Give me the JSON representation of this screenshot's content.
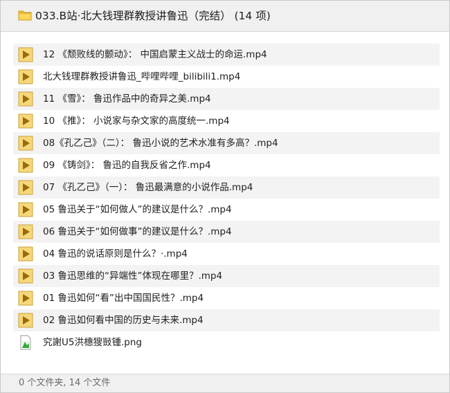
{
  "window": {
    "title": "033.B站·北大钱理群教授讲鲁迅（完结） (14 项)",
    "title_icon": "folder-icon"
  },
  "files": [
    {
      "name": "12 《颓败线的颤动》： 中国启蒙主义战士的命运.mp4",
      "type": "video",
      "icon": "video-file-icon"
    },
    {
      "name": "北大钱理群教授讲鲁迅_哔哩哔哩_bilibili1.mp4",
      "type": "video",
      "icon": "video-file-icon"
    },
    {
      "name": "11 《雪》： 鲁迅作品中的奇异之美.mp4",
      "type": "video",
      "icon": "video-file-icon"
    },
    {
      "name": "10 《推》： 小说家与杂文家的高度统一.mp4",
      "type": "video",
      "icon": "video-file-icon"
    },
    {
      "name": "08《孔乙己》（二）： 鲁迅小说的艺术水准有多高？.mp4",
      "type": "video",
      "icon": "video-file-icon"
    },
    {
      "name": "09 《铸剑》： 鲁迅的自我反省之作.mp4",
      "type": "video",
      "icon": "video-file-icon"
    },
    {
      "name": "07 《孔乙己》（一）： 鲁迅最满意的小说作品.mp4",
      "type": "video",
      "icon": "video-file-icon"
    },
    {
      "name": "05 鲁迅关于“如何做人”的建议是什么？.mp4",
      "type": "video",
      "icon": "video-file-icon"
    },
    {
      "name": "06 鲁迅关于“如何做事”的建议是什么？.mp4",
      "type": "video",
      "icon": "video-file-icon"
    },
    {
      "name": "04 鲁迅的说话原则是什么？·.mp4",
      "type": "video",
      "icon": "video-file-icon"
    },
    {
      "name": "03 鲁迅思维的“异端性”体现在哪里？.mp4",
      "type": "video",
      "icon": "video-file-icon"
    },
    {
      "name": "01 鲁迅如何“看”出中国国民性？.mp4",
      "type": "video",
      "icon": "video-file-icon"
    },
    {
      "name": "02 鲁迅如何看中国的历史与未来.mp4",
      "type": "video",
      "icon": "video-file-icon"
    },
    {
      "name": "究謝U5洪橞獀敱锺.png",
      "type": "image",
      "icon": "image-file-icon"
    }
  ],
  "status": {
    "summary": "0 个文件夹, 14 个文件"
  },
  "colors": {
    "video_icon_fill": "#f6d77a",
    "video_icon_border": "#c8a23c",
    "play_triangle": "#9a6b08",
    "row_alt_bg": "#f3f3f3"
  }
}
